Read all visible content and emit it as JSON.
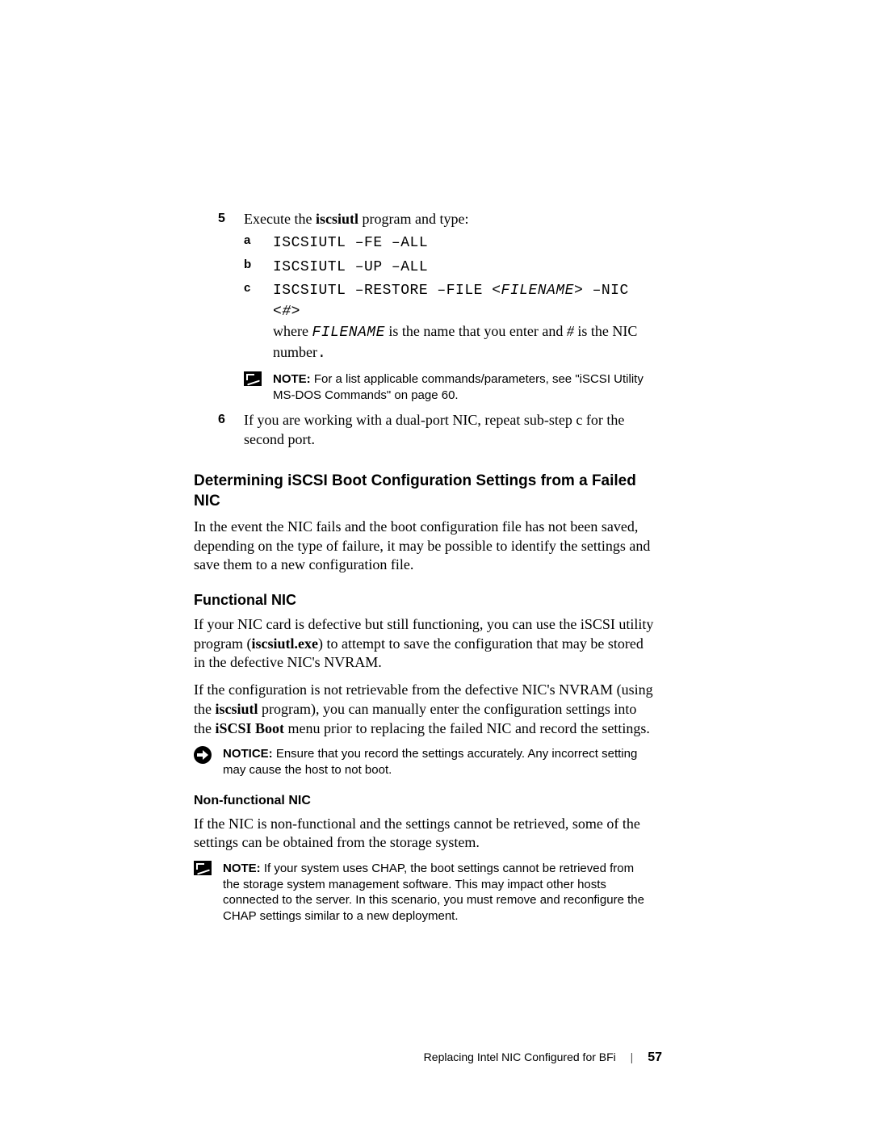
{
  "steps": {
    "s5": {
      "num": "5",
      "intro_pre": "Execute the ",
      "intro_bold": "iscsiutl",
      "intro_post": " program and type:",
      "a": {
        "letter": "a",
        "cmd": "ISCSIUTL –FE –ALL"
      },
      "b": {
        "letter": "b",
        "cmd": "ISCSIUTL –UP –ALL"
      },
      "c": {
        "letter": "c",
        "cmd_pre": "ISCSIUTL –RESTORE –FILE <",
        "cmd_fname": "FILENAME",
        "cmd_mid": "> –NIC <",
        "cmd_hash": "#",
        "cmd_post": ">",
        "where_pre": "where ",
        "where_var1": "FILENAME",
        "where_mid": " is the name that you enter and ",
        "where_var2": "#",
        "where_post": " is the NIC number",
        "where_dot": "."
      },
      "note": {
        "label": "NOTE:",
        "text": " For a list applicable commands/parameters, see \"iSCSI Utility MS-DOS Commands\" on page 60."
      }
    },
    "s6": {
      "num": "6",
      "text": "If you are working with a dual-port NIC, repeat sub-step c for the second port."
    }
  },
  "sec1": {
    "heading": "Determining iSCSI Boot Configuration Settings from a Failed NIC",
    "para": "In the event the NIC fails and the boot configuration file has not been saved, depending on the type of failure, it may be possible to identify the settings and save them to a new configuration file."
  },
  "sec2": {
    "heading": "Functional NIC",
    "p1_pre": "If your NIC card is defective but still functioning, you can use the iSCSI utility program (",
    "p1_bold": "iscsiutl.exe",
    "p1_post": ") to attempt to save the configuration that may be stored in the defective NIC's NVRAM.",
    "p2_pre": "If the configuration is not retrievable from the defective NIC's NVRAM (using the ",
    "p2_b1": "iscsiutl",
    "p2_mid": " program), you can manually enter the configuration settings into the ",
    "p2_b2": "iSCSI Boot",
    "p2_post": " menu prior to replacing the failed NIC and record the settings.",
    "notice": {
      "label": "NOTICE:",
      "text": " Ensure that you record the settings accurately. Any incorrect setting may cause the host to not boot."
    }
  },
  "sec3": {
    "heading": "Non-functional NIC",
    "para": "If the NIC is non-functional and the settings cannot be retrieved, some of the settings can be obtained from the storage system.",
    "note": {
      "label": "NOTE:",
      "text": " If your system uses CHAP, the boot settings cannot be retrieved from the storage system management software. This may impact other hosts connected to the server. In this scenario, you must remove and reconfigure the CHAP settings similar to a new deployment."
    }
  },
  "footer": {
    "title": "Replacing Intel NIC Configured for BFi",
    "page": "57"
  }
}
